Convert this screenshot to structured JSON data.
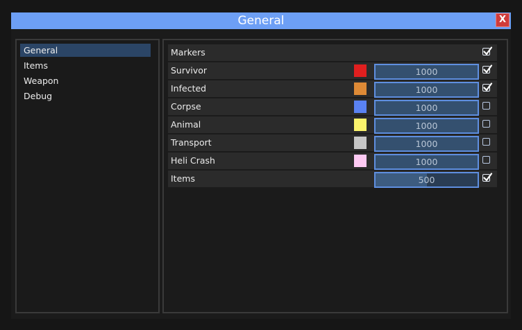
{
  "window": {
    "title": "General",
    "close_label": "X"
  },
  "sidebar": {
    "items": [
      {
        "label": "General",
        "active": true
      },
      {
        "label": "Items",
        "active": false
      },
      {
        "label": "Weapon",
        "active": false
      },
      {
        "label": "Debug",
        "active": false
      }
    ]
  },
  "markers": {
    "header_label": "Markers",
    "header_checked": true,
    "rows": [
      {
        "label": "Survivor",
        "color": "#e01f1f",
        "value": "1000",
        "checked": true
      },
      {
        "label": "Infected",
        "color": "#de8a36",
        "value": "1000",
        "checked": true
      },
      {
        "label": "Corpse",
        "color": "#5a82f2",
        "value": "1000",
        "checked": false
      },
      {
        "label": "Animal",
        "color": "#fbf36c",
        "value": "1000",
        "checked": false
      },
      {
        "label": "Transport",
        "color": "#c6c6c6",
        "value": "1000",
        "checked": false
      },
      {
        "label": "Heli Crash",
        "color": "#fdc9f2",
        "value": "1000",
        "checked": false
      }
    ],
    "items_row": {
      "label": "Items",
      "value": "500",
      "fill_fraction": 0.5,
      "checked": true
    }
  }
}
